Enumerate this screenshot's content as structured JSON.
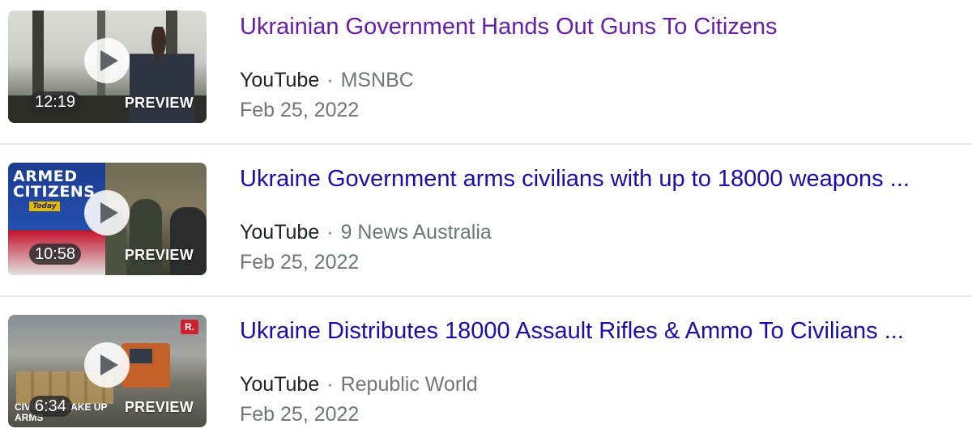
{
  "colors": {
    "title_visited": "#681da8",
    "title_unvisited": "#1a0dab",
    "meta_gray": "#70757a",
    "site_text": "#202124"
  },
  "results": [
    {
      "title": "Ukrainian Government Hands Out Guns To Citizens",
      "visited": true,
      "site": "YouTube",
      "separator": "·",
      "channel": "MSNBC",
      "date": "Feb 25, 2022",
      "duration": "12:19",
      "preview_label": "PREVIEW",
      "play_icon": "play-icon"
    },
    {
      "title": "Ukraine Government arms civilians with up to 18000 weapons ...",
      "visited": false,
      "site": "YouTube",
      "separator": "·",
      "channel": "9 News Australia",
      "date": "Feb 25, 2022",
      "duration": "10:58",
      "preview_label": "PREVIEW",
      "play_icon": "play-icon",
      "thumbnail_text": {
        "headline": "ARMED CITIZENS",
        "tag": "Today"
      }
    },
    {
      "title": "Ukraine Distributes 18000 Assault Rifles & Ammo To Civilians ...",
      "visited": false,
      "site": "YouTube",
      "separator": "·",
      "channel": "Republic World",
      "date": "Feb 25, 2022",
      "duration": "6:34",
      "preview_label": "PREVIEW",
      "play_icon": "play-icon",
      "thumbnail_text": {
        "logo": "R.",
        "strap": "CIVILIANS TAKE UP ARMS"
      }
    }
  ]
}
